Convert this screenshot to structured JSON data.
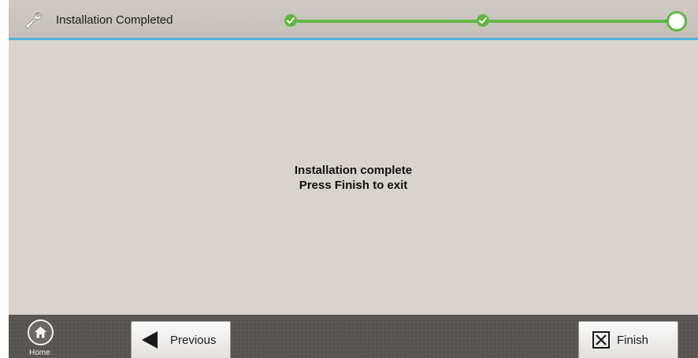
{
  "header": {
    "title": "Installation Completed",
    "icon": "wrench-icon",
    "accent_color": "#4fb3dc"
  },
  "progress": {
    "steps": [
      {
        "state": "completed"
      },
      {
        "state": "completed"
      },
      {
        "state": "current"
      }
    ],
    "color": "#62b544"
  },
  "message": {
    "line1": "Installation complete",
    "line2": "Press Finish to exit"
  },
  "footer": {
    "home_label": "Home",
    "previous_label": "Previous",
    "finish_label": "Finish"
  }
}
